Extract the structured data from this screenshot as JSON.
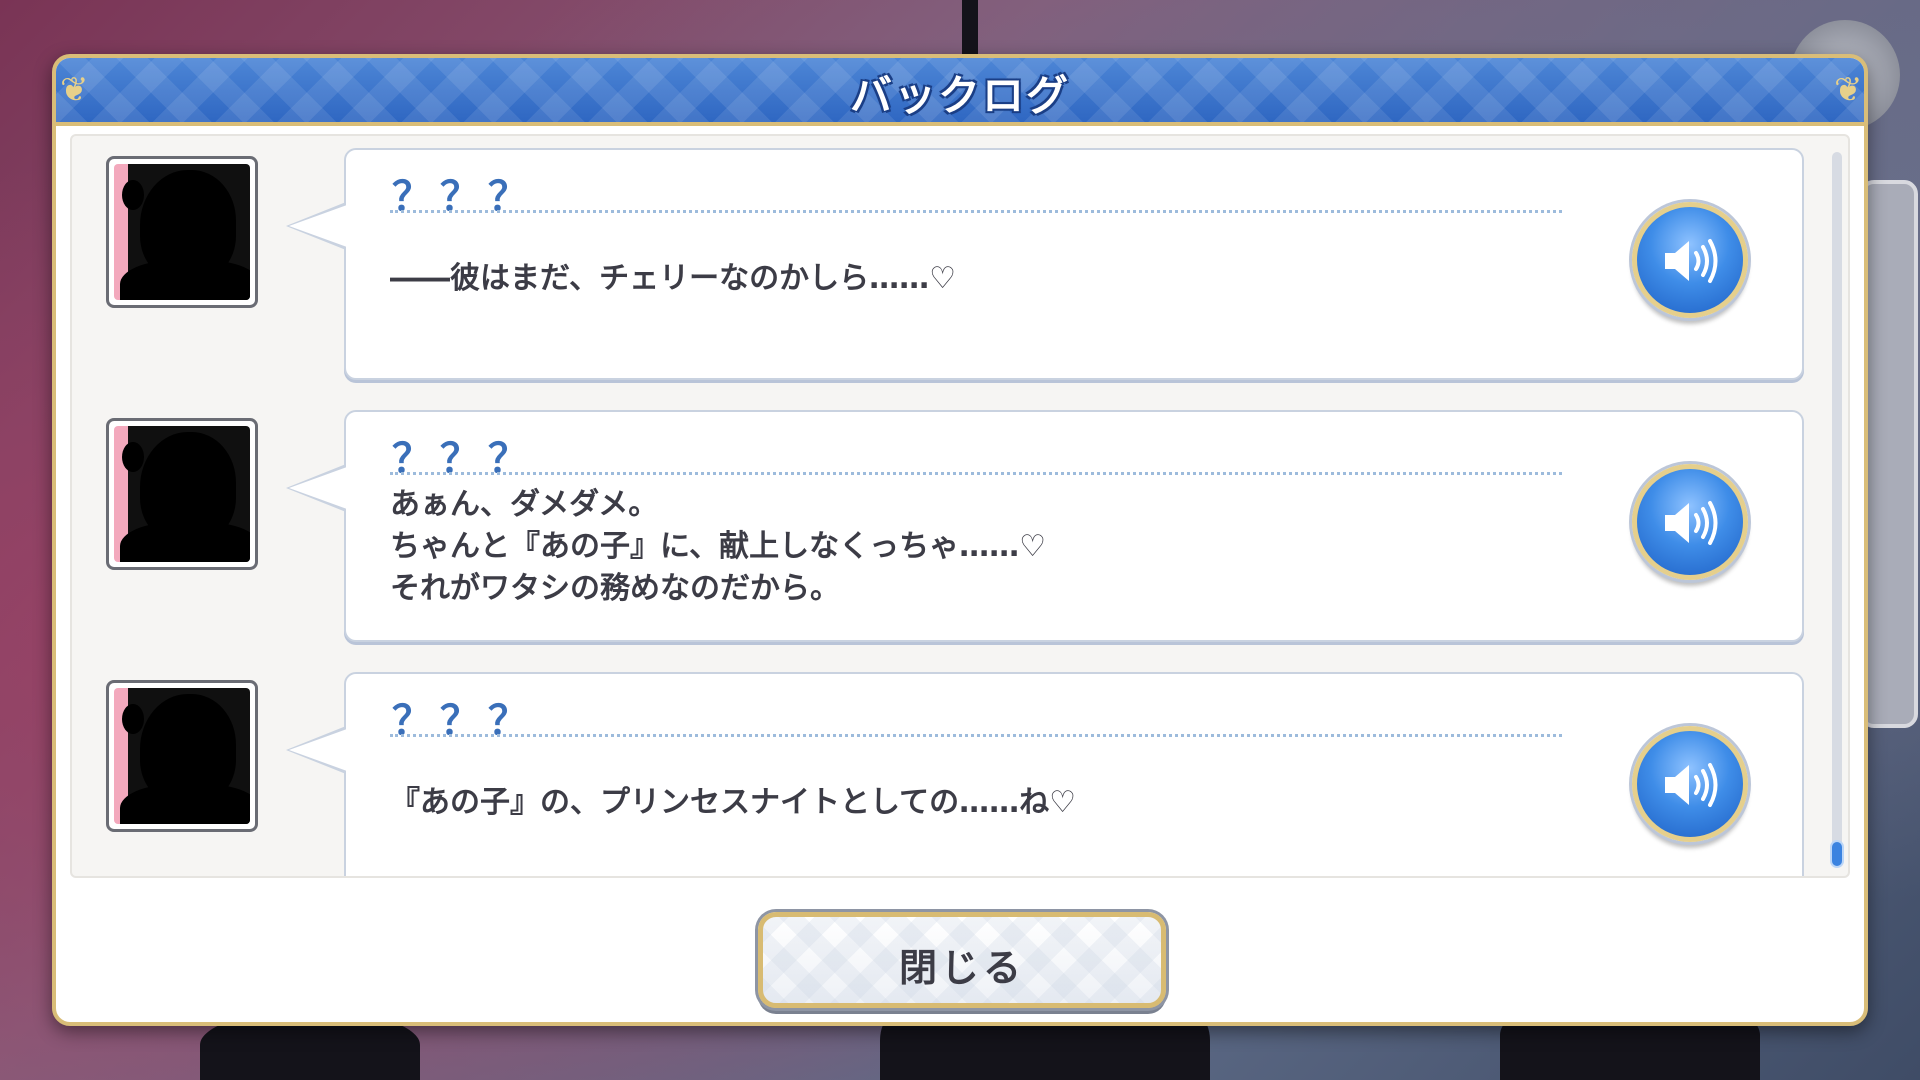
{
  "window": {
    "title": "バックログ"
  },
  "entries": [
    {
      "speaker": "？？？",
      "text": "――彼はまだ、チェリーなのかしら……♡",
      "voice_icon": "speaker-volume-icon"
    },
    {
      "speaker": "？？？",
      "text": "あぁん、ダメダメ。\nちゃんと『あの子』に、献上しなくっちゃ……♡\nそれがワタシの務めなのだから。",
      "voice_icon": "speaker-volume-icon"
    },
    {
      "speaker": "？？？",
      "text": "『あの子』の、プリンセスナイトとしての……ね♡",
      "voice_icon": "speaker-volume-icon"
    }
  ],
  "footer": {
    "close_label": "閉じる"
  },
  "colors": {
    "header": "#2f67c2",
    "gold_border": "#d9bd78",
    "speaker_name": "#3a6fb9",
    "voice_button": "#3f8de8"
  }
}
